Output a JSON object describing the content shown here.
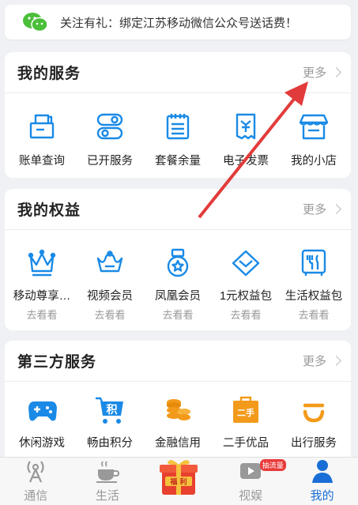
{
  "banner": {
    "text": "关注有礼：绑定江苏移动微信公众号送话费！",
    "icon": "wechat-icon"
  },
  "services": {
    "title": "我的服务",
    "more": "更多",
    "items": [
      {
        "label": "账单查询",
        "icon": "bill-icon"
      },
      {
        "label": "已开服务",
        "icon": "toggle-icon"
      },
      {
        "label": "套餐余量",
        "icon": "notepad-icon"
      },
      {
        "label": "电子发票",
        "icon": "invoice-icon"
      },
      {
        "label": "我的小店",
        "icon": "shop-icon"
      }
    ]
  },
  "benefits": {
    "title": "我的权益",
    "more": "更多",
    "items": [
      {
        "label": "移动尊享…",
        "sub": "去看看",
        "icon": "crown-icon"
      },
      {
        "label": "视频会员",
        "sub": "去看看",
        "icon": "crown-outline-icon"
      },
      {
        "label": "凤凰会员",
        "sub": "去看看",
        "icon": "medal-icon"
      },
      {
        "label": "1元权益包",
        "sub": "去看看",
        "icon": "diamond-icon"
      },
      {
        "label": "生活权益包",
        "sub": "去看看",
        "icon": "dining-icon"
      }
    ]
  },
  "third_party": {
    "title": "第三方服务",
    "more": "更多",
    "items": [
      {
        "label": "休闲游戏",
        "icon": "gamepad-icon"
      },
      {
        "label": "畅由积分",
        "icon": "points-cart-icon",
        "glyph": "积"
      },
      {
        "label": "金融信用",
        "icon": "coins-icon"
      },
      {
        "label": "二手优品",
        "icon": "secondhand-icon",
        "glyph": "二手"
      },
      {
        "label": "出行服务",
        "icon": "didi-icon"
      }
    ]
  },
  "tabbar": {
    "items": [
      {
        "label": "通信",
        "icon": "signal-tower-icon"
      },
      {
        "label": "生活",
        "icon": "coffee-icon"
      },
      {
        "label": "",
        "icon": "welfare-gift-icon",
        "glyph": "福 利"
      },
      {
        "label": "视娱",
        "icon": "video-icon",
        "badge": "抽流量"
      },
      {
        "label": "我的",
        "icon": "user-icon",
        "active": true
      }
    ]
  },
  "colors": {
    "accent": "#1a8ae6",
    "active": "#1a6fd6",
    "orange": "#f39a1a",
    "arrow": "#e23b3b"
  }
}
